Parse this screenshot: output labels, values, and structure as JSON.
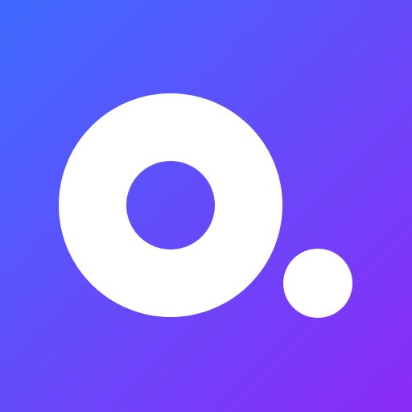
{
  "icon": {
    "name": "app-logo",
    "description_icon": "ring-with-dot-icon",
    "colors": {
      "gradient_start": "#3E6BFF",
      "gradient_end": "#8B2BF5",
      "mark": "#FFFFFF"
    }
  }
}
